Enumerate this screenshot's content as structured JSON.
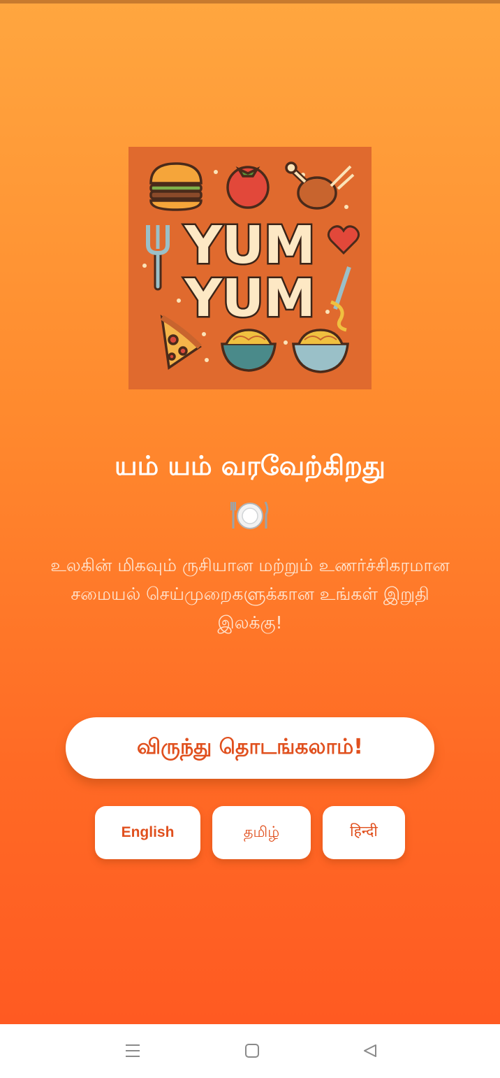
{
  "logo": {
    "line1": "YUM",
    "line2": "YUM"
  },
  "welcome": {
    "title": "யம் யம் வரவேற்கிறது",
    "icon": "plate-cutlery-icon",
    "subtitle": "உலகின் மிகவும் ருசியான மற்றும் உணர்ச்சிகரமான சமையல் செய்முறைகளுக்கான உங்கள் இறுதி இலக்கு!"
  },
  "actions": {
    "start_label": "விருந்து தொடங்கலாம்!"
  },
  "languages": [
    {
      "label": "English"
    },
    {
      "label": "தமிழ்"
    },
    {
      "label": "हिन्दी"
    }
  ],
  "navbar": {
    "icons": [
      "menu-icon",
      "home-icon",
      "back-icon"
    ]
  },
  "colors": {
    "gradient_top": "#ffa63f",
    "gradient_bottom": "#ff5a22",
    "accent_text": "#e0501e",
    "logo_bg": "#e06a2e"
  }
}
